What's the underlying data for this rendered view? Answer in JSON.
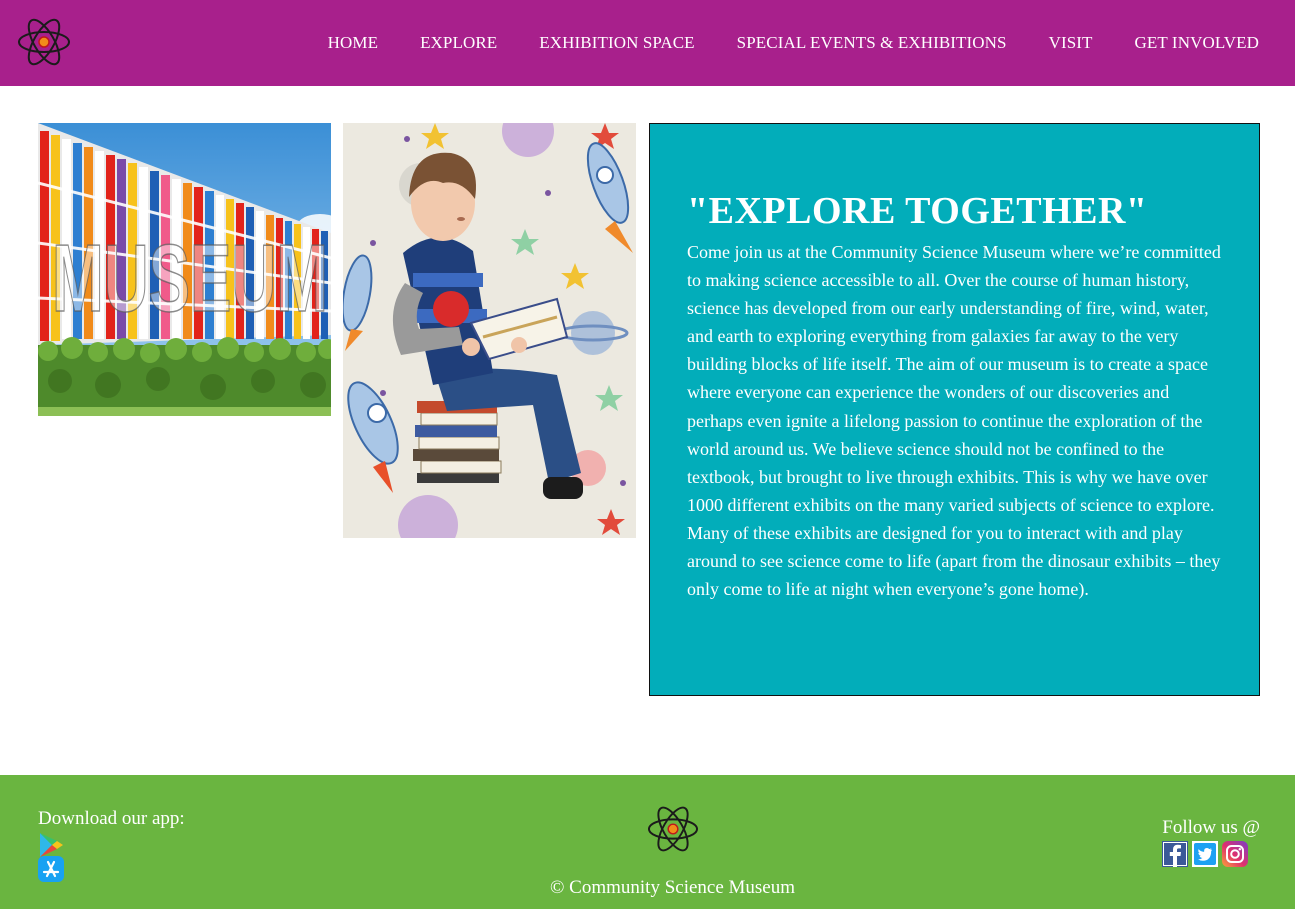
{
  "nav": {
    "items": [
      "HOME",
      "EXPLORE",
      "EXHIBITION SPACE",
      "SPECIAL EVENTS & EXHIBITIONS",
      "VISIT",
      "GET INVOLVED"
    ]
  },
  "photos": {
    "museum_wall_text": "MUSEUM"
  },
  "intro": {
    "heading": "\"EXPLORE TOGETHER\"",
    "body": "Come join us at the Community Science Museum where we’re committed to making science accessible to all. Over the course of human history, science has developed from our early understanding of fire, wind, water, and earth to exploring everything from galaxies far away to the very building blocks of life itself. The aim of our museum is to create a space where everyone can experience the wonders of our discoveries and perhaps even ignite a lifelong passion to continue the exploration of the world around us. We believe science should not be confined to the textbook, but brought to live through exhibits. This is why we have over 1000 different exhibits on the many varied subjects of science to explore. Many of these exhibits are designed for you to interact with and play around to see science come to life (apart from the dinosaur exhibits – they only come to life at night when everyone’s gone home)."
  },
  "footer": {
    "download_label": "Download our app:",
    "copyright": "© Community Science Museum",
    "follow_label": "Follow us @"
  },
  "icons": {
    "logo": "atom-icon",
    "stores": [
      "google-play-icon",
      "app-store-icon"
    ],
    "socials": [
      "facebook-icon",
      "twitter-icon",
      "instagram-icon"
    ]
  },
  "colors": {
    "header_bg": "#a8208c",
    "infobox_bg": "#02adba",
    "footer_bg": "#6ab540",
    "text_light": "#ffffff"
  }
}
